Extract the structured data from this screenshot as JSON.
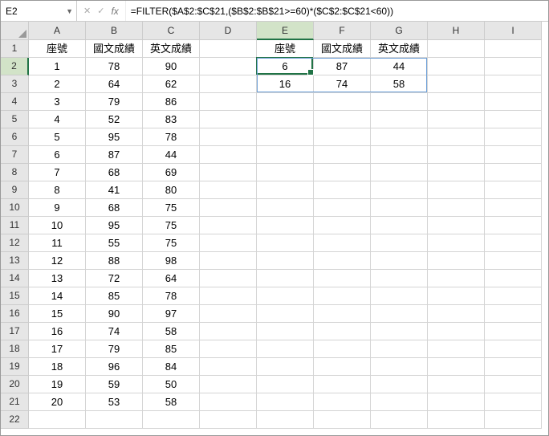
{
  "formula_bar": {
    "cell_ref": "E2",
    "formula": "=FILTER($A$2:$C$21,($B$2:$B$21>=60)*($C$2:$C$21<60))"
  },
  "columns": [
    "A",
    "B",
    "C",
    "D",
    "E",
    "F",
    "G",
    "H",
    "I"
  ],
  "row_count": 22,
  "active": {
    "col": "E",
    "row": 2
  },
  "spill": {
    "startCol": "E",
    "endCol": "G",
    "startRow": 2,
    "endRow": 3
  },
  "headers_left": {
    "A": "座號",
    "B": "國文成績",
    "C": "英文成績"
  },
  "headers_right": {
    "E": "座號",
    "F": "國文成績",
    "G": "英文成績"
  },
  "data_left": [
    {
      "A": "1",
      "B": "78",
      "C": "90"
    },
    {
      "A": "2",
      "B": "64",
      "C": "62"
    },
    {
      "A": "3",
      "B": "79",
      "C": "86"
    },
    {
      "A": "4",
      "B": "52",
      "C": "83"
    },
    {
      "A": "5",
      "B": "95",
      "C": "78"
    },
    {
      "A": "6",
      "B": "87",
      "C": "44"
    },
    {
      "A": "7",
      "B": "68",
      "C": "69"
    },
    {
      "A": "8",
      "B": "41",
      "C": "80"
    },
    {
      "A": "9",
      "B": "68",
      "C": "75"
    },
    {
      "A": "10",
      "B": "95",
      "C": "75"
    },
    {
      "A": "11",
      "B": "55",
      "C": "75"
    },
    {
      "A": "12",
      "B": "88",
      "C": "98"
    },
    {
      "A": "13",
      "B": "72",
      "C": "64"
    },
    {
      "A": "14",
      "B": "85",
      "C": "78"
    },
    {
      "A": "15",
      "B": "90",
      "C": "97"
    },
    {
      "A": "16",
      "B": "74",
      "C": "58"
    },
    {
      "A": "17",
      "B": "79",
      "C": "85"
    },
    {
      "A": "18",
      "B": "96",
      "C": "84"
    },
    {
      "A": "19",
      "B": "59",
      "C": "50"
    },
    {
      "A": "20",
      "B": "53",
      "C": "58"
    }
  ],
  "data_right": [
    {
      "E": "6",
      "F": "87",
      "G": "44"
    },
    {
      "E": "16",
      "F": "74",
      "G": "58"
    }
  ]
}
